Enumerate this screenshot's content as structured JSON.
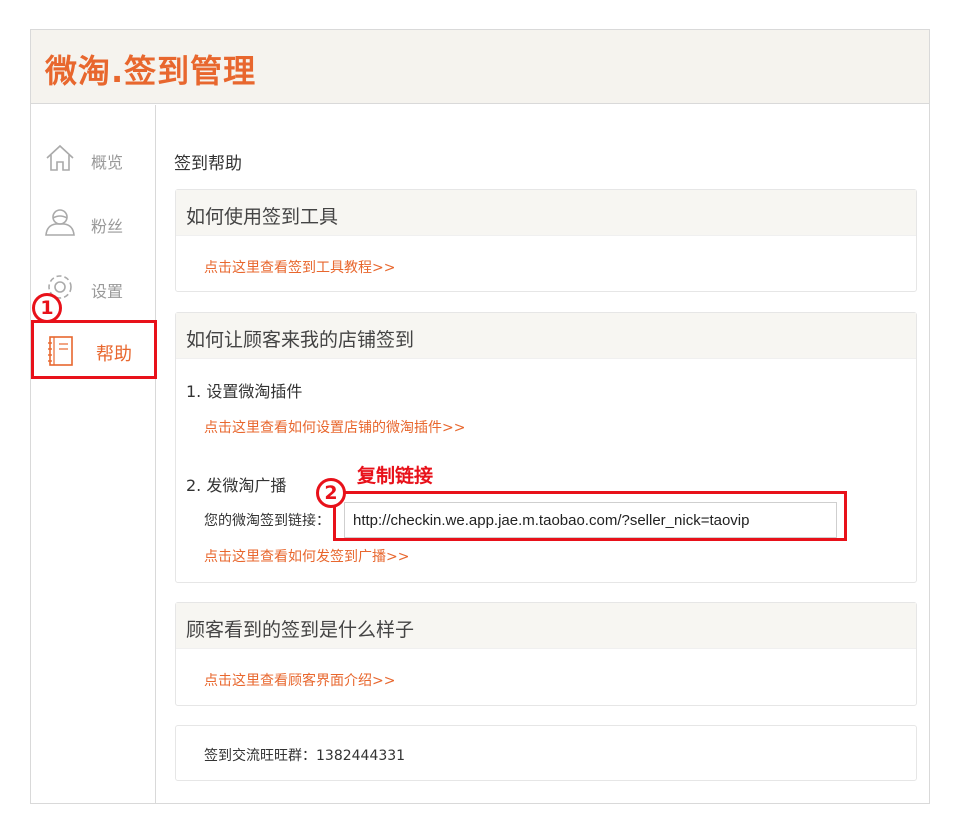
{
  "brand": {
    "title": "微淘.签到管理"
  },
  "colors": {
    "accent": "#e8672e",
    "highlight": "#e8111a"
  },
  "sidebar": {
    "items": [
      {
        "label": "概览",
        "icon": "home-icon"
      },
      {
        "label": "粉丝",
        "icon": "user-icon"
      },
      {
        "label": "设置",
        "icon": "gear-icon"
      },
      {
        "label": "帮助",
        "icon": "notebook-icon",
        "active": true
      }
    ]
  },
  "annotations": {
    "marker1": "1",
    "marker2": "2",
    "copy_link": "复制链接"
  },
  "main": {
    "title": "签到帮助",
    "sections": [
      {
        "title": "如何使用签到工具",
        "link": "点击这里查看签到工具教程>>"
      },
      {
        "title": "如何让顾客来我的店铺签到",
        "step1": "1. 设置微淘插件",
        "link1": "点击这里查看如何设置店铺的微淘插件>>",
        "step2": "2. 发微淘广播",
        "link_label": "您的微淘签到链接：",
        "link_value": "http://checkin.we.app.jae.m.taobao.com/?seller_nick=taovip",
        "link2": "点击这里查看如何发签到广播>>"
      },
      {
        "title": "顾客看到的签到是什么样子",
        "link": "点击这里查看顾客界面介绍>>"
      }
    ],
    "group": "签到交流旺旺群：1382444331"
  }
}
